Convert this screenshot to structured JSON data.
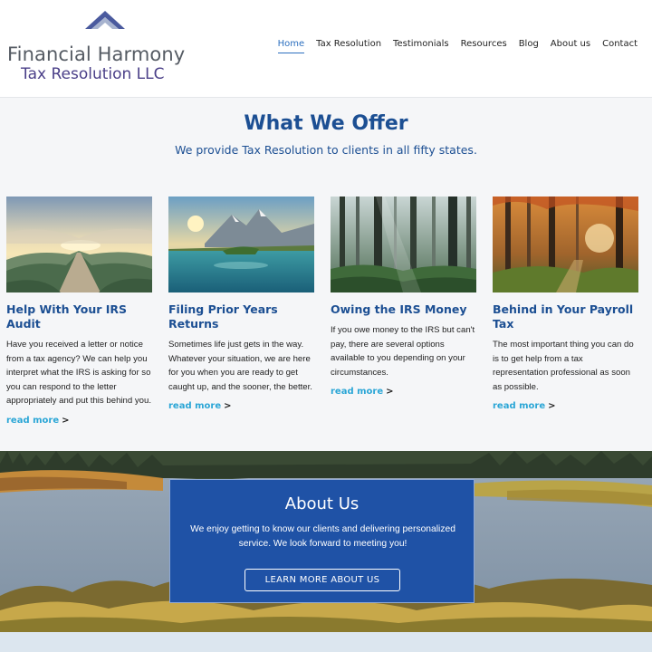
{
  "logo": {
    "line1": "Financial Harmony",
    "line2": "Tax Resolution LLC",
    "mark_icon": "roof-chevron-icon"
  },
  "nav": {
    "items": [
      {
        "label": "Home",
        "active": true
      },
      {
        "label": "Tax Resolution",
        "active": false
      },
      {
        "label": "Testimonials",
        "active": false
      },
      {
        "label": "Resources",
        "active": false
      },
      {
        "label": "Blog",
        "active": false
      },
      {
        "label": "About us",
        "active": false
      },
      {
        "label": "Contact",
        "active": false
      }
    ]
  },
  "offer": {
    "title": "What We Offer",
    "subtitle": "We provide Tax Resolution to clients in all fifty states.",
    "cards": [
      {
        "image": "mountain-path-sunrise",
        "title": "Help With Your IRS Audit",
        "text": "Have you received a letter or notice from a tax agency? We can help you interpret what the IRS is asking for so you can respond to the letter appropriately and put this behind you.",
        "link": "read more"
      },
      {
        "image": "mountain-lake-sunrise",
        "title": "Filing Prior Years Returns",
        "text": "Sometimes life just gets in the way. Whatever your situation, we are here for you when you are ready to get caught up, and the sooner, the better.",
        "link": "read more"
      },
      {
        "image": "misty-forest",
        "title": "Owing the IRS Money",
        "text": "If you owe money to the IRS but can't pay, there are several options available to you depending on your circumstances.",
        "link": "read more"
      },
      {
        "image": "autumn-forest-sunlight",
        "title": "Behind in Your Payroll Tax",
        "text": "The most important thing you can do is to get help from a tax representation professional as soon as possible.",
        "link": "read more"
      }
    ]
  },
  "about": {
    "title": "About Us",
    "text": "We enjoy getting to know our clients and delivering personalized service. We look forward to meeting you!",
    "button": "LEARN MORE ABOUT US",
    "background_image": "lake-with-forest-and-shrubs"
  },
  "colors": {
    "brand_blue": "#1c4f93",
    "link_cyan": "#2ba6d6",
    "about_box": "#1f52a6",
    "logo_purple": "#4a3f88"
  }
}
